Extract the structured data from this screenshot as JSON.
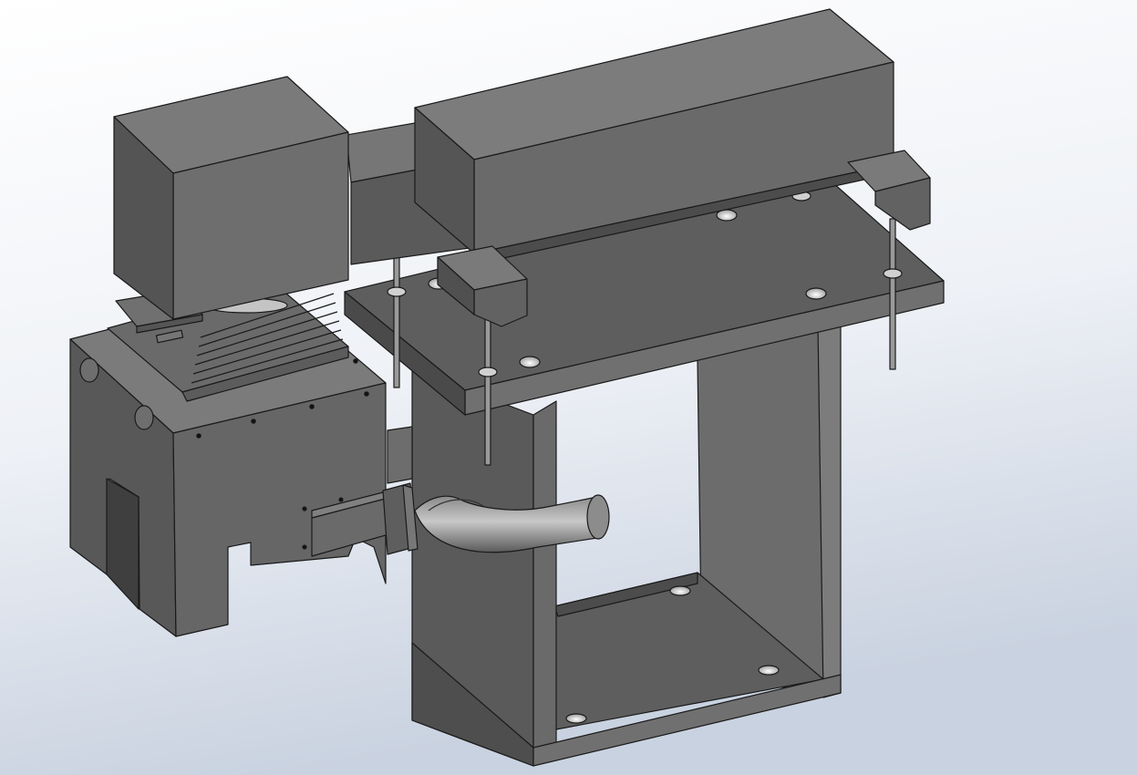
{
  "viewport": {
    "background_top": "#ffffff",
    "background_bottom": "#c9d2e0",
    "part_face_light": "#7a7a7a",
    "part_face_mid": "#646464",
    "part_face_dark": "#545454",
    "edge_color": "#1a1a1a",
    "hole_color": "#d8d8d8"
  },
  "model": {
    "components": [
      "motor-block-icon",
      "horizontal-beam-icon",
      "mounting-plate-icon",
      "threaded-rod-icon",
      "support-frame-icon",
      "housing-icon",
      "cooling-fins-icon",
      "elbow-pipe-icon",
      "flange-icon"
    ]
  }
}
